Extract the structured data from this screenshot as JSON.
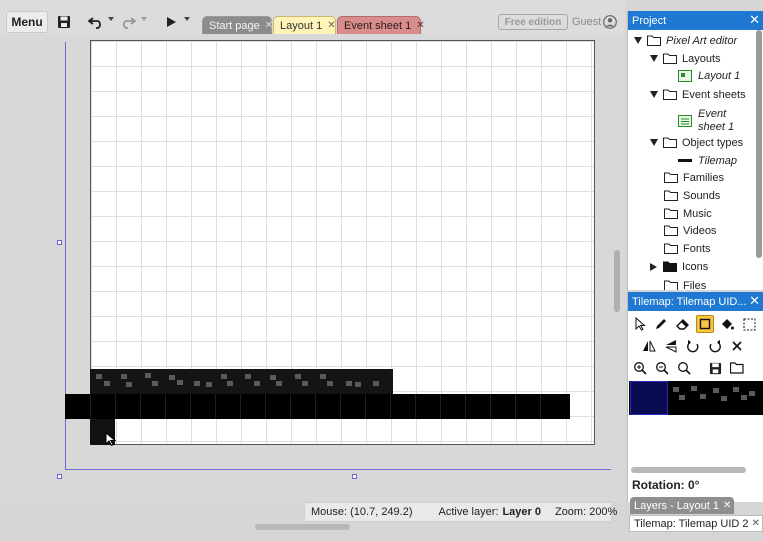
{
  "toolbar": {
    "menu_label": "Menu",
    "tabs": [
      {
        "label": "Start page"
      },
      {
        "label": "Layout 1"
      },
      {
        "label": "Event sheet 1"
      }
    ],
    "free_edition_label": "Free edition",
    "guest_label": "Guest",
    "icons": [
      "save-icon",
      "undo-icon",
      "redo-icon",
      "play-icon",
      "user-icon"
    ]
  },
  "statusbar": {
    "mouse": "Mouse: (10.7, 249.2)",
    "active_layer_prefix": "Active layer:",
    "active_layer": "Layer 0",
    "zoom": "Zoom: 200%"
  },
  "project": {
    "title": "Project",
    "items": [
      {
        "label": "Pixel Art editor"
      },
      {
        "label": "Layouts"
      },
      {
        "label": "Layout 1"
      },
      {
        "label": "Event sheets"
      },
      {
        "label": "Event"
      },
      {
        "label": "sheet 1"
      },
      {
        "label": "Object types"
      },
      {
        "label": "Tilemap"
      },
      {
        "label": "Families"
      },
      {
        "label": "Sounds"
      },
      {
        "label": "Music"
      },
      {
        "label": "Videos"
      },
      {
        "label": "Fonts"
      },
      {
        "label": "Icons"
      },
      {
        "label": "Files"
      }
    ]
  },
  "tilemap_panel": {
    "title": "Tilemap: Tilemap UID...",
    "rotation": "Rotation: 0°",
    "tools": [
      "cursor-icon",
      "pencil-icon",
      "eraser-icon",
      "rectangle-icon",
      "fill-icon",
      "selection-icon",
      "mirror-icon",
      "flip-icon",
      "rotate-ccw-icon",
      "rotate-cw-icon",
      "reset-icon",
      "zoom-in-icon",
      "zoom-out-icon",
      "zoom-reset-icon",
      "save-icon",
      "folder-open-icon"
    ]
  },
  "bottom_tabs": [
    {
      "label": "Layers - Layout 1"
    },
    {
      "label": "Tilemap: Tilemap UID 2"
    }
  ],
  "colors": {
    "accent": "#1f78d1",
    "layout_tab": "#fff3b8",
    "event_tab": "#d98c8c",
    "start_tab": "#8c8c8c",
    "layout_bounds": "#6b6bd6"
  }
}
